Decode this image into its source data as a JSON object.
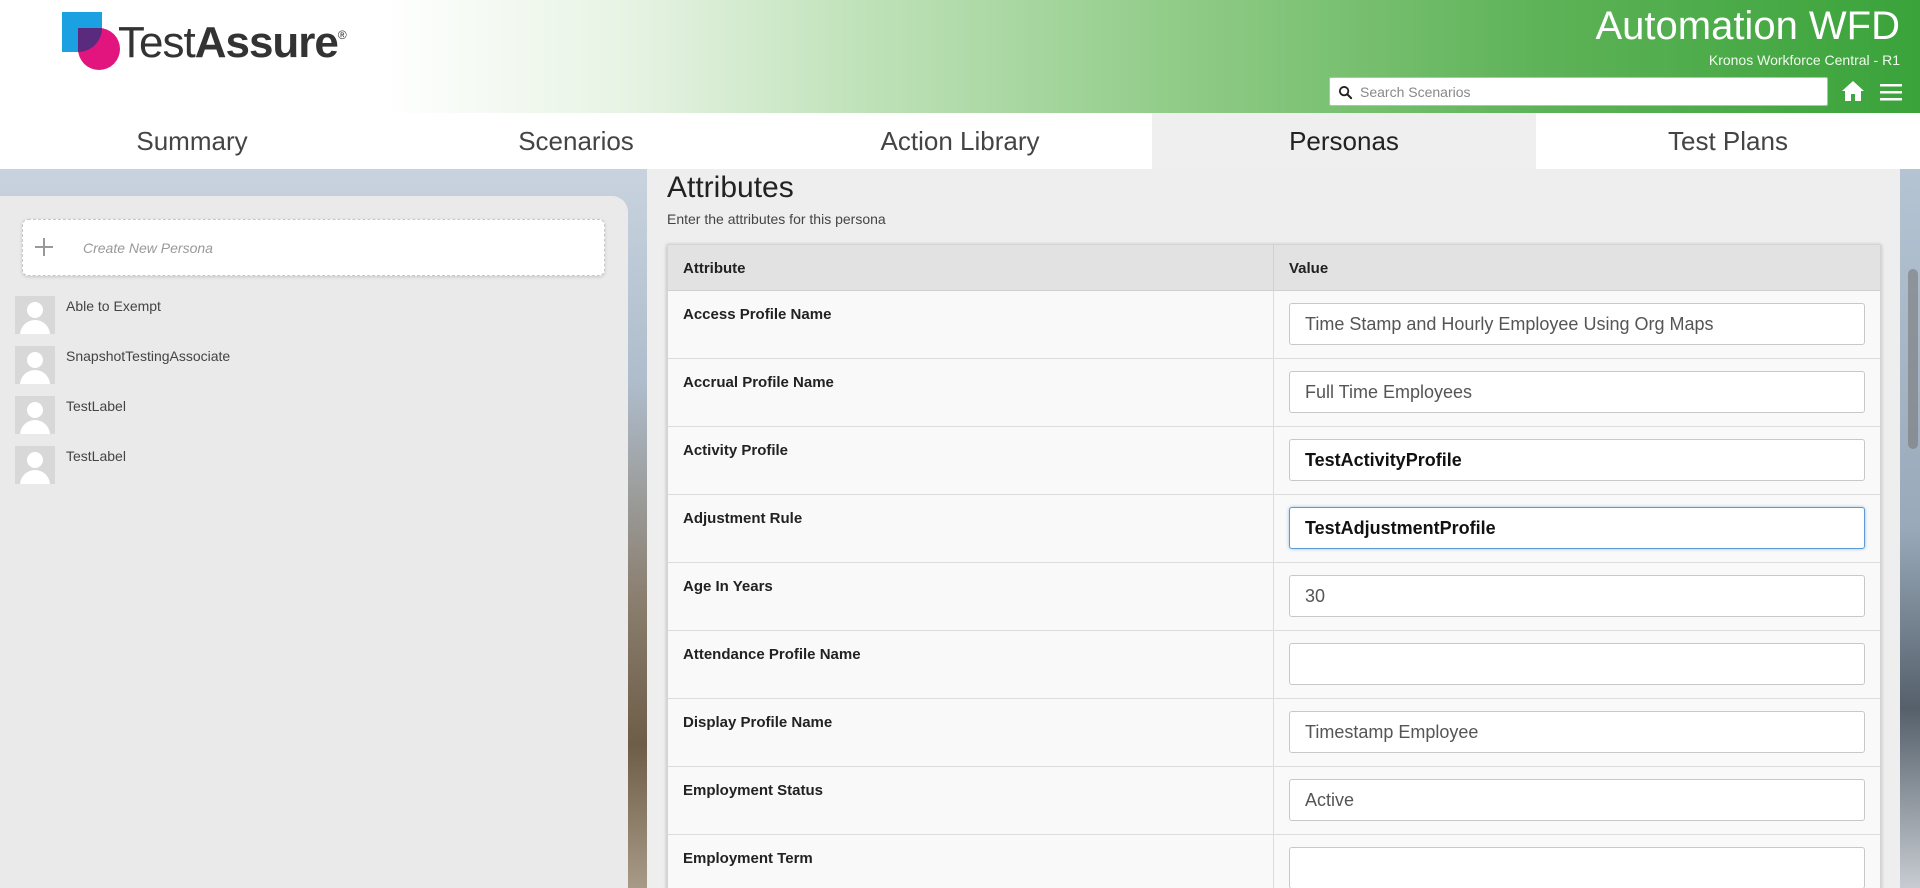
{
  "brand": {
    "logo_text_light": "Test",
    "logo_text_bold": "Assure",
    "logo_reg": "®"
  },
  "header": {
    "title": "Automation WFD",
    "subtitle": "Kronos Workforce Central - R1",
    "search_placeholder": "Search Scenarios"
  },
  "tabs": [
    {
      "label": "Summary"
    },
    {
      "label": "Scenarios"
    },
    {
      "label": "Action Library"
    },
    {
      "label": "Personas",
      "active": true
    },
    {
      "label": "Test Plans"
    }
  ],
  "sidebar": {
    "create_label": "Create New Persona",
    "personas": [
      {
        "name": "Able to Exempt"
      },
      {
        "name": "SnapshotTestingAssociate"
      },
      {
        "name": "TestLabel"
      },
      {
        "name": "TestLabel"
      }
    ]
  },
  "main": {
    "title": "Attributes",
    "description": "Enter the attributes for this persona",
    "columns": {
      "attribute": "Attribute",
      "value": "Value"
    },
    "rows": [
      {
        "attribute": "Access Profile Name",
        "value": "Time Stamp and Hourly Employee Using Org Maps"
      },
      {
        "attribute": "Accrual Profile Name",
        "value": "Full Time Employees"
      },
      {
        "attribute": "Activity Profile",
        "value": "TestActivityProfile"
      },
      {
        "attribute": "Adjustment Rule",
        "value": "TestAdjustmentProfile"
      },
      {
        "attribute": "Age In Years",
        "value": "30"
      },
      {
        "attribute": "Attendance Profile Name",
        "value": ""
      },
      {
        "attribute": "Display Profile Name",
        "value": "Timestamp Employee"
      },
      {
        "attribute": "Employment Status",
        "value": "Active"
      },
      {
        "attribute": "Employment Term",
        "value": ""
      }
    ]
  },
  "colors": {
    "header_green": "#3aa33a",
    "accent_blue": "#1ba0e2",
    "accent_pink": "#e2147d"
  }
}
